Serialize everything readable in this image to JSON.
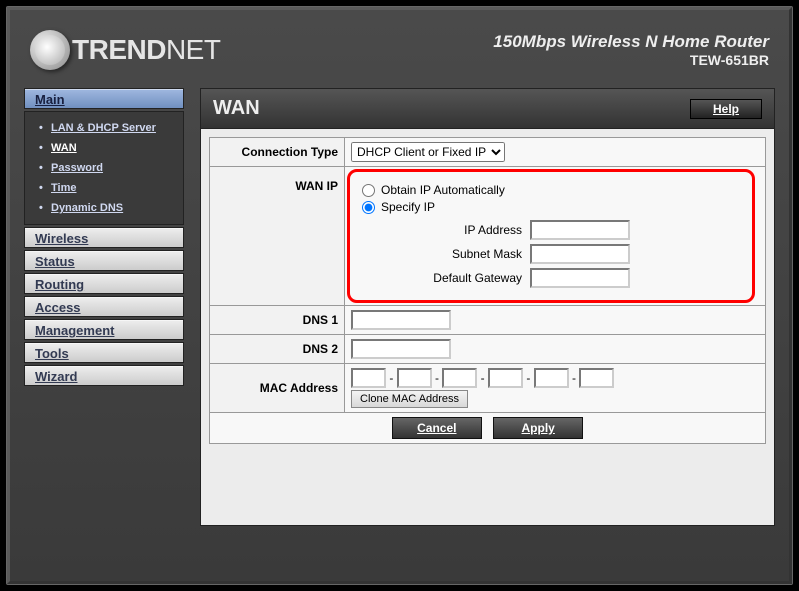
{
  "brand": {
    "name_part1": "TREND",
    "name_part2": "NET"
  },
  "header": {
    "title": "150Mbps Wireless N Home Router",
    "model": "TEW-651BR"
  },
  "sidebar": {
    "sections": [
      "Main",
      "Wireless",
      "Status",
      "Routing",
      "Access",
      "Management",
      "Tools",
      "Wizard"
    ],
    "active": "Main",
    "submenu": [
      "LAN & DHCP Server",
      "WAN",
      "Password",
      "Time",
      "Dynamic DNS"
    ],
    "current": "WAN"
  },
  "page": {
    "title": "WAN",
    "help_label": "Help",
    "labels": {
      "connection_type": "Connection Type",
      "wan_ip": "WAN IP",
      "dns1": "DNS 1",
      "dns2": "DNS 2",
      "mac_address": "MAC Address"
    },
    "connection_type_value": "DHCP Client or Fixed IP",
    "radio": {
      "obtain": "Obtain IP Automatically",
      "specify": "Specify IP"
    },
    "sub_labels": {
      "ip": "IP Address",
      "subnet": "Subnet Mask",
      "gateway": "Default Gateway"
    },
    "clone_btn": "Clone MAC Address",
    "buttons": {
      "cancel": "Cancel",
      "apply": "Apply"
    }
  }
}
